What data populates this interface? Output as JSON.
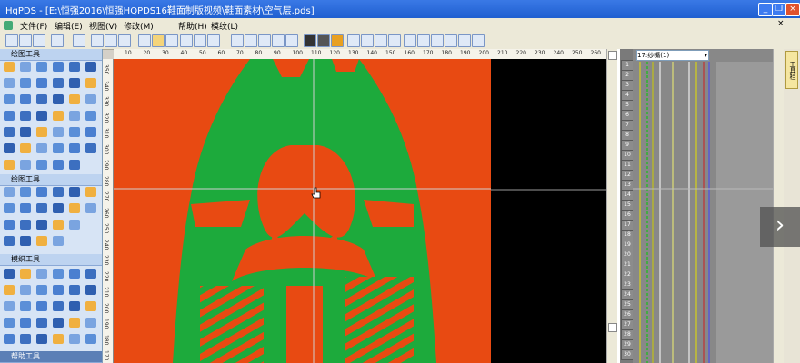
{
  "window": {
    "title": "HqPDS - [E:\\恒强2016\\恒强HQPDS16鞋面制版视频\\鞋面素材\\空气层.pds]",
    "minimize": "_",
    "restore": "❐",
    "close": "×"
  },
  "menu": {
    "items": [
      "文件(F)",
      "编辑(E)",
      "视图(V)",
      "修改(M)",
      "帮助(H)",
      "模纹(L)"
    ]
  },
  "left_panel": {
    "section1": "绘图工具",
    "section2": "绘图工具",
    "section3": "模织工具",
    "section4": "帮助工具"
  },
  "ruler": {
    "top_ticks": [
      "10",
      "20",
      "30",
      "40",
      "50",
      "60",
      "70",
      "80",
      "90",
      "100",
      "110",
      "120",
      "130",
      "140",
      "150",
      "160",
      "170",
      "180",
      "190",
      "200",
      "210",
      "220",
      "230",
      "240",
      "250",
      "260"
    ],
    "left_ticks": [
      "350",
      "340",
      "330",
      "320",
      "310",
      "300",
      "290",
      "280",
      "270",
      "260",
      "250",
      "240",
      "230",
      "220",
      "210",
      "200",
      "190",
      "180",
      "170"
    ]
  },
  "color_panel": {
    "combo_value": "17:纱嘴(1)",
    "numbers": [
      "1",
      "2",
      "3",
      "4",
      "5",
      "6",
      "7",
      "8",
      "9",
      "10",
      "11",
      "12",
      "13",
      "14",
      "15",
      "16",
      "17",
      "18",
      "19",
      "20",
      "21",
      "22",
      "23",
      "24",
      "25",
      "26",
      "27",
      "28",
      "29",
      "30"
    ]
  },
  "right_strip": {
    "tab_label": "工具栏"
  },
  "overlay": {
    "next_arrow": "›"
  },
  "colors": {
    "canvas_bg": "#e84a12",
    "pattern_green": "#1daa3c",
    "title_blue": "#2a66d9"
  }
}
